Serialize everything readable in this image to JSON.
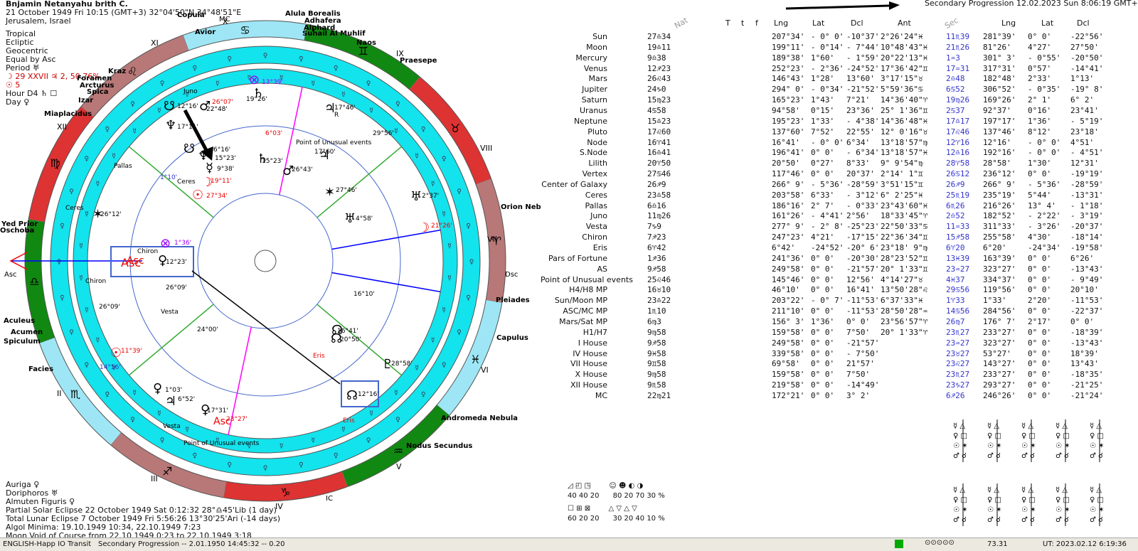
{
  "header": {
    "name": "Bnjamin Netanyahu brith C.",
    "datetime": "21 October 1949  Fri  10:15 (GMT+3) 32°04'50\"N  34°48'51\"E",
    "place": "Jerusalem, Israel",
    "lines": [
      "Tropical",
      "Ecliptic",
      "Geocentric",
      "Equal by Asc",
      "Period ♅",
      "☽   29 XXVII ♃ 2, 50.76%",
      "☉   5",
      "Hour D4 ♄ ☐",
      "Day ♀"
    ]
  },
  "bottom_left": [
    "Auriga ♀",
    "Doriphoros ♅",
    "Almuten Figuris ♀",
    "Partial Solar Eclipse 22 October 1949 Sat  0:12:32 28°♎45'Lib (1 day)",
    "Total Lunar Eclipse 7 October 1949 Fri  5:56:26 13°30'25'Ari (-14 days)",
    "Algol Minima: 19.10.1949 10:34, 22.10.1949  7:23",
    "Moon Void of Course from 22.10.1949  0:23 to 22.10.1949  3:18"
  ],
  "secondary_header": "Secondary Progression 12.02.2023  Sun  8:06:19 GMT+2",
  "columns": {
    "nat": "Nat",
    "t": "T",
    "t2": "t",
    "f": "f",
    "lng": "Lng",
    "lat": "Lat",
    "dcl": "Dcl",
    "ant": "Ant",
    "sec": "Sec",
    "lng2": "Lng",
    "lat2": "Lat",
    "dcl2": "Dcl"
  },
  "rows": [
    {
      "name": "Sun",
      "n": "27♎34",
      "lng": "207°34'",
      "lat": "- 0° 0'",
      "dcl": "-10°37'",
      "ant": "2°26'24\"♓",
      "s": "11♏39",
      "lng2": "281°39'",
      "lat2": "0° 0'",
      "dcl2": "-22°56'"
    },
    {
      "name": "Moon",
      "n": "19♎11",
      "lng": "199°11'",
      "lat": "- 0°14'",
      "dcl": "- 7°44'",
      "ant": "10°48'43\"♓",
      "s": "21♏26",
      "lng2": "81°26'",
      "lat2": "4°27'",
      "dcl2": "27°50'"
    },
    {
      "name": "Mercury",
      "n": "9♎38",
      "lng": "189°38'",
      "lat": "1°60'",
      "dcl": "- 1°59'",
      "ant": "20°22'13\"♓",
      "s": "1♒3",
      "lng2": "301° 3'",
      "lat2": "- 0°55'",
      "dcl2": "-20°50'"
    },
    {
      "name": "Venus",
      "n": "12♐23",
      "lng": "252°23'",
      "lat": "- 2°36'",
      "dcl": "-24°52'",
      "ant": "17°36'42\"♊",
      "s": "17♒31",
      "lng2": "317°31'",
      "lat2": "0°57'",
      "dcl2": "-14°41'"
    },
    {
      "name": "Mars",
      "n": "26♌43",
      "lng": "146°43'",
      "lat": "1°28'",
      "dcl": "13°60'",
      "ant": "3°17'15\"♉",
      "s": "2♎48",
      "lng2": "182°48'",
      "lat2": "2°33'",
      "dcl2": "1°13'"
    },
    {
      "name": "Jupiter",
      "n": "24♑0",
      "lng": "294° 0'",
      "lat": "- 0°34'",
      "dcl": "-21°52'",
      "ant": "5°59'36\"♋",
      "s": "6♋52",
      "lng2": "306°52'",
      "lat2": "- 0°35'",
      "dcl2": "-19° 8'"
    },
    {
      "name": "Saturn",
      "n": "15♍23",
      "lng": "165°23'",
      "lat": "1°43'",
      "dcl": "7°21'",
      "ant": "14°36'40\"♈",
      "s": "19♍26",
      "lng2": "169°26'",
      "lat2": "2° 1'",
      "dcl2": "6° 2'"
    },
    {
      "name": "Uranus",
      "n": "4♋58",
      "lng": "94°58'",
      "lat": "0°15'",
      "dcl": "23°36'",
      "ant": "25° 1'36\"♊",
      "s": "2♋37",
      "lng2": "92°37'",
      "lat2": "0°16'",
      "dcl2": "23°41'"
    },
    {
      "name": "Neptune",
      "n": "15♎23",
      "lng": "195°23'",
      "lat": "1°33'",
      "dcl": "- 4°38'",
      "ant": "14°36'48\"♓",
      "s": "17♎17",
      "lng2": "197°17'",
      "lat2": "1°36'",
      "dcl2": "- 5°19'"
    },
    {
      "name": "Pluto",
      "n": "17♌60",
      "lng": "137°60'",
      "lat": "7°52'",
      "dcl": "22°55'",
      "ant": "12° 0'16\"♉",
      "s": "17♌46",
      "lng2": "137°46'",
      "lat2": "8°12'",
      "dcl2": "23°18'"
    },
    {
      "name": "Node",
      "n": "16♈41",
      "lng": "16°41'",
      "lat": "- 0° 0'",
      "dcl": "6°34'",
      "ant": "13°18'57\"♍",
      "s": "12♈16",
      "lng2": "12°16'",
      "lat2": "- 0° 0'",
      "dcl2": "4°51'"
    },
    {
      "name": "S.Node",
      "n": "16♎41",
      "lng": "196°41'",
      "lat": "0° 0'",
      "dcl": "- 6°34'",
      "ant": "13°18'57\"♓",
      "s": "12♎16",
      "lng2": "192°16'",
      "lat2": "- 0° 0'",
      "dcl2": "- 4°51'"
    },
    {
      "name": "Lilith",
      "n": "20♈50",
      "lng": "20°50'",
      "lat": "0°27'",
      "dcl": "8°33'",
      "ant": "9° 9'54\"♍",
      "s": "28♈58",
      "lng2": "28°58'",
      "lat2": "1°30'",
      "dcl2": "12°31'"
    },
    {
      "name": "Vertex",
      "n": "27♋46",
      "lng": "117°46'",
      "lat": "0° 0'",
      "dcl": "20°37'",
      "ant": "2°14' 1\"♊",
      "s": "26♋12",
      "lng2": "236°12'",
      "lat2": "0° 0'",
      "dcl2": "-19°19'"
    },
    {
      "name": "Center of Galaxy",
      "n": "26♐9",
      "lng": "266° 9'",
      "lat": "- 5°36'",
      "dcl": "-28°59'",
      "ant": "3°51'15\"♊",
      "s": "26♐9",
      "lng2": "266° 9'",
      "lat2": "- 5°36'",
      "dcl2": "-28°59'"
    },
    {
      "name": "Ceres",
      "n": "23♎58",
      "lng": "203°58'",
      "lat": "6°33'",
      "dcl": "- 3°12'",
      "ant": "6° 2'25\"♓",
      "s": "25♏19",
      "lng2": "235°19'",
      "lat2": "5°44'",
      "dcl2": "-13°31'"
    },
    {
      "name": "Pallas",
      "n": "6♎16",
      "lng": "186°16'",
      "lat": "2° 7'",
      "dcl": "- 0°33'",
      "ant": "23°43'60\"♓",
      "s": "6♏26",
      "lng2": "216°26'",
      "lat2": "13° 4'",
      "dcl2": "- 1°18'"
    },
    {
      "name": "Juno",
      "n": "11♍26",
      "lng": "161°26'",
      "lat": "- 4°41'",
      "dcl": "2°56'",
      "ant": "18°33'45\"♈",
      "s": "2♎52",
      "lng2": "182°52'",
      "lat2": "- 2°22'",
      "dcl2": "- 3°19'"
    },
    {
      "name": "Vesta",
      "n": "7♑9",
      "lng": "277° 9'",
      "lat": "- 2° 8'",
      "dcl": "-25°23'",
      "ant": "22°50'33\"♋",
      "s": "11♒33",
      "lng2": "311°33'",
      "lat2": "- 3°26'",
      "dcl2": "-20°37'"
    },
    {
      "name": "Chiron",
      "n": "7♐23",
      "lng": "247°23'",
      "lat": "4°21'",
      "dcl": "-17°15'",
      "ant": "22°36'34\"♊",
      "s": "15♐58",
      "lng2": "255°58'",
      "lat2": "4°30'",
      "dcl2": "-18°14'"
    },
    {
      "name": "Eris",
      "n": "6♈42",
      "lng": "6°42'",
      "lat": "-24°52'",
      "dcl": "-20° 6'",
      "ant": "23°18' 9\"♍",
      "s": "6♈20",
      "lng2": "6°20'",
      "lat2": "-24°34'",
      "dcl2": "-19°58'"
    },
    {
      "name": "Pars of Fortune",
      "n": "1♐36",
      "lng": "241°36'",
      "lat": "0° 0'",
      "dcl": "-20°30'",
      "ant": "28°23'52\"♊",
      "s": "13♓39",
      "lng2": "163°39'",
      "lat2": "0° 0'",
      "dcl2": "6°26'"
    },
    {
      "name": "AS",
      "n": "9♐58",
      "lng": "249°58'",
      "lat": "0° 0'",
      "dcl": "-21°57'",
      "ant": "20° 1'33\"♊",
      "s": "23♒27",
      "lng2": "323°27'",
      "lat2": "0° 0'",
      "dcl2": "-13°43'"
    },
    {
      "name": "Point of Unusual events",
      "n": "25♌46",
      "lng": "145°46'",
      "lat": "0° 0'",
      "dcl": "12°56'",
      "ant": "4°14'27\"♉",
      "s": "4♓37",
      "lng2": "334°37'",
      "lat2": "0° 0'",
      "dcl2": "- 9°49'"
    },
    {
      "name": "H4/H8 MP",
      "n": "16♉10",
      "lng": "46°10'",
      "lat": "0° 0'",
      "dcl": "16°41'",
      "ant": "13°50'28\"♌",
      "s": "29♋56",
      "lng2": "119°56'",
      "lat2": "0° 0'",
      "dcl2": "20°10'"
    },
    {
      "name": "Sun/Moon MP",
      "n": "23♎22",
      "lng": "203°22'",
      "lat": "- 0° 7'",
      "dcl": "-11°53'",
      "ant": "6°37'33\"♓",
      "s": "1♈33",
      "lng2": "1°33'",
      "lat2": "2°20'",
      "dcl2": "-11°53'"
    },
    {
      "name": "ASC/MC MP",
      "n": "1♏10",
      "lng": "211°10'",
      "lat": "0° 0'",
      "dcl": "-11°53'",
      "ant": "28°50'28\"♒",
      "s": "14♋56",
      "lng2": "284°56'",
      "lat2": "0° 0'",
      "dcl2": "-22°37'"
    },
    {
      "name": "Mars/Sat MP",
      "n": "6♍3",
      "lng": "156° 3'",
      "lat": "1°36'",
      "dcl": "0° 0'",
      "ant": "23°56'57\"♈",
      "s": "26♍7",
      "lng2": "176° 7'",
      "lat2": "2°17'",
      "dcl2": "0° 0'"
    },
    {
      "name": "H1/H7",
      "n": "9♍58",
      "lng": "159°58'",
      "lat": "0° 0'",
      "dcl": "7°50'",
      "ant": "20° 1'33\"♈",
      "s": "23♏27",
      "lng2": "233°27'",
      "lat2": "0° 0'",
      "dcl2": "-18°39'"
    },
    {
      "name": "I House",
      "n": "9♐58",
      "lng": "249°58'",
      "lat": "0° 0'",
      "dcl": "-21°57'",
      "ant": "",
      "s": "23♒27",
      "lng2": "323°27'",
      "lat2": "0° 0'",
      "dcl2": "-13°43'"
    },
    {
      "name": "IV House",
      "n": "9♓58",
      "lng": "339°58'",
      "lat": "0° 0'",
      "dcl": "- 7°50'",
      "ant": "",
      "s": "23♉27",
      "lng2": "53°27'",
      "lat2": "0° 0'",
      "dcl2": "18°39'"
    },
    {
      "name": "VII House",
      "n": "9♊58",
      "lng": "69°58'",
      "lat": "0° 0'",
      "dcl": "21°57'",
      "ant": "",
      "s": "23♌27",
      "lng2": "143°27'",
      "lat2": "0° 0'",
      "dcl2": "13°43'"
    },
    {
      "name": "X House",
      "n": "9♍58",
      "lng": "159°58'",
      "lat": "0° 0'",
      "dcl": "7°50'",
      "ant": "",
      "s": "23♏27",
      "lng2": "233°27'",
      "lat2": "0° 0'",
      "dcl2": "-18°35'"
    },
    {
      "name": "XII House",
      "n": "9♏58",
      "lng": "219°58'",
      "lat": "0° 0'",
      "dcl": "-14°49'",
      "ant": "",
      "s": "23♑27",
      "lng2": "293°27'",
      "lat2": "0° 0'",
      "dcl2": "-21°25'"
    },
    {
      "name": "MC",
      "n": "22♍21",
      "lng": "172°21'",
      "lat": "0° 0'",
      "dcl": "3° 2'",
      "ant": "",
      "s": "6♐26",
      "lng2": "246°26'",
      "lat2": "0° 0'",
      "dcl2": "-21°24'"
    }
  ],
  "stats": {
    "a": "40  40  20",
    "b": "80  20  70  30 %",
    "c": "60  20  20",
    "d": "30  20  40  10 %"
  },
  "chart_labels": {
    "stars": [
      "Alula Borealis",
      "Adhafera",
      "Alphard",
      "Suhail Al Muhlif",
      "Naos",
      "Praesepe",
      "Copula",
      "Avior",
      "Kraz",
      "Foramen",
      "Arcturus",
      "Spica",
      "Izar",
      "Miaplacidus",
      "Yed Prior",
      "Oschoba",
      "Orion Nebula",
      "Pleiades",
      "Capulus",
      "Andromeda Nebula",
      "Nodus Secundus",
      "Aculeus",
      "Acumen",
      "Spiculum",
      "Facies"
    ],
    "houses": [
      "XI",
      "X",
      "IX",
      "VIII",
      "XII",
      "VII",
      "I",
      "VI",
      "II",
      "V",
      "III",
      "IV"
    ],
    "angles": [
      "MC",
      "Asc",
      "Dsc",
      "IC"
    ],
    "points": [
      "13°39'",
      "19°26'",
      "17°46'",
      "R",
      "26°07'",
      "12°16'",
      "22°48'",
      "17°11'",
      "6°16'",
      "15°23'",
      "9°38'",
      "Juno",
      "19°11'",
      "27°34'",
      "Ceres",
      "Pallas",
      "1°10'",
      "29°56'",
      "Point of Unusual events",
      "17°60'",
      "15°23'",
      "26°43'",
      "27°46'",
      "2°37'",
      "4°58'",
      "26°12'",
      "Ceres",
      "21°26'",
      "1°36'",
      "Chiron",
      "Asc",
      "12°23'",
      "Chiron",
      "26°09'",
      "26°09'",
      "Vesta",
      "16°10'",
      "24°00'",
      "16°41'",
      "20°50'",
      "Eris",
      "28°58'",
      "11°39'",
      "14°56'",
      "12°16'",
      "1°03'",
      "6°52'",
      "17°31'",
      "Asc",
      "23°27'",
      "Vesta",
      "Point of Unusual events",
      "Eris",
      "6°03'"
    ]
  },
  "status": {
    "lang": "ENGLISH-Happ IO Transit",
    "prog": "Secondary Progression -- 2.01.1950 14:45:32 -- 0.20",
    "val": "73.31",
    "ut": "UT: 2023.02.12  6:19:36"
  }
}
